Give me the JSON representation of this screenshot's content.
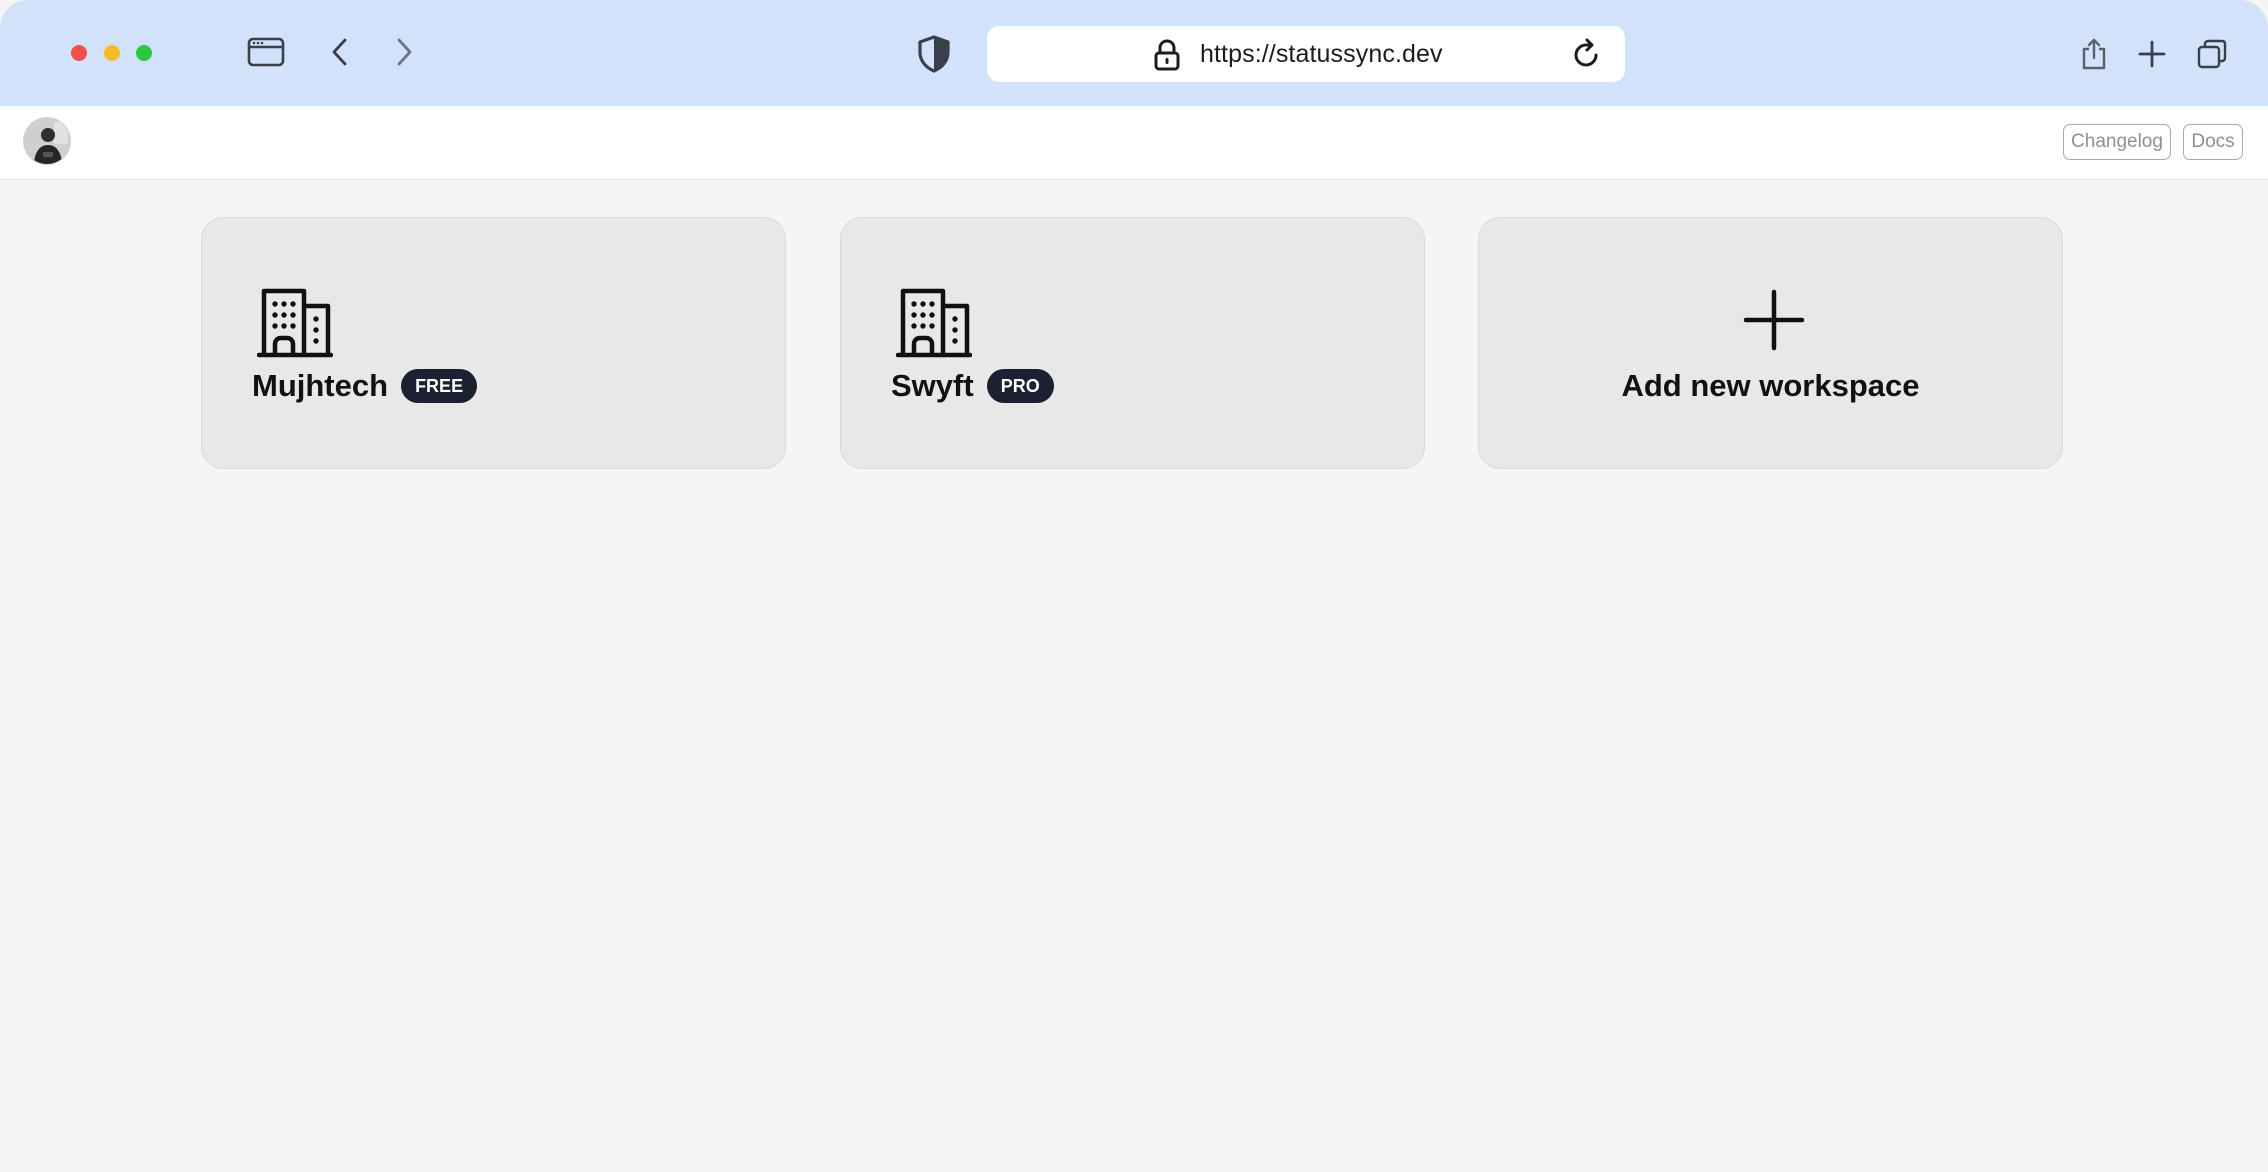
{
  "browser": {
    "url": "https://statussync.dev",
    "traffic_lights": {
      "close": "#f0514b",
      "minimize": "#f6ba28",
      "maximize": "#2cc63f"
    },
    "chrome_color": "#d3e2fb",
    "icons": [
      "sidebar-icon",
      "back-chevron-icon",
      "forward-chevron-icon",
      "shield-icon",
      "lock-icon",
      "reload-icon",
      "share-icon",
      "new-tab-plus-icon",
      "tabs-overview-icon"
    ]
  },
  "header": {
    "avatar_icon": "user-avatar",
    "links": {
      "changelog": "Changelog",
      "docs": "Docs"
    }
  },
  "workspaces": [
    {
      "name": "Mujhtech",
      "plan": "FREE",
      "icon": "building-icon"
    },
    {
      "name": "Swyft",
      "plan": "PRO",
      "icon": "building-icon"
    }
  ],
  "add_workspace": {
    "label": "Add new workspace",
    "icon": "plus-icon"
  },
  "colors": {
    "page_background": "#f5f5f5",
    "card_background": "#e8e8e8",
    "badge_background": "#1b2130",
    "badge_text": "#ffffff"
  }
}
